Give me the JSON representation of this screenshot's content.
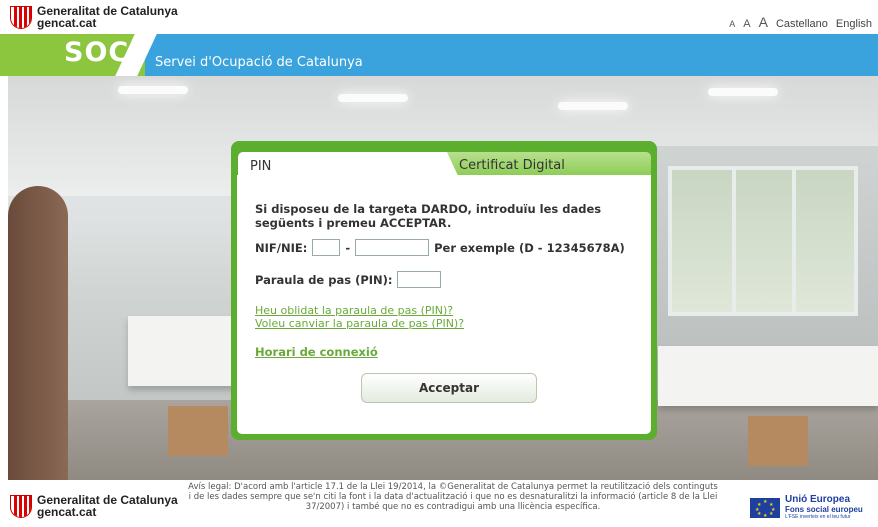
{
  "header": {
    "logo_line1": "Generalitat de Catalunya",
    "logo_line2": "gencat.cat",
    "font_small": "A",
    "font_medium": "A",
    "font_large": "A",
    "lang_castellano": "Castellano",
    "lang_english": "English"
  },
  "brand": {
    "name": "SOC",
    "subtitle": "Servei d'Ocupació de Catalunya",
    "blue": "#3aa3dd",
    "green": "#8cc63f"
  },
  "login": {
    "tab_pin": "PIN",
    "tab_cert": "Certificat Digital",
    "instructions": "Si disposeu de la targeta DARDO, introduïu les dades següents i premeu ACCEPTAR.",
    "nif_label": "NIF/NIE:",
    "nif_part1_value": "",
    "nif_separator": "-",
    "nif_part2_value": "",
    "nif_example": "Per exemple (D - 12345678A)",
    "pass_label": "Paraula de pas (PIN):",
    "pass_value": "",
    "link_forgot": "Heu oblidat la paraula de pas (PIN)?",
    "link_change": "Voleu canviar la paraula de pas (PIN)?",
    "link_horari": "Horari de connexió",
    "submit_label": "Acceptar",
    "accent": "#5cae2e"
  },
  "footer": {
    "logo_line1": "Generalitat de Catalunya",
    "logo_line2": "gencat.cat",
    "legal": "Avís legal: D'acord amb l'article 17.1 de la Llei 19/2014, la ©Generalitat de Catalunya permet la reutilització dels continguts i de les dades sempre que se'n citi la font i la data d'actualització i que no es desnaturalitzi la informació (article 8 de la Llei 37/2007) i també que no es contradigui amb una llicència específica.",
    "eu_line1": "Unió Europea",
    "eu_line2": "Fons social europeu",
    "eu_line3": "L'FSE inverteix en el teu futur"
  }
}
